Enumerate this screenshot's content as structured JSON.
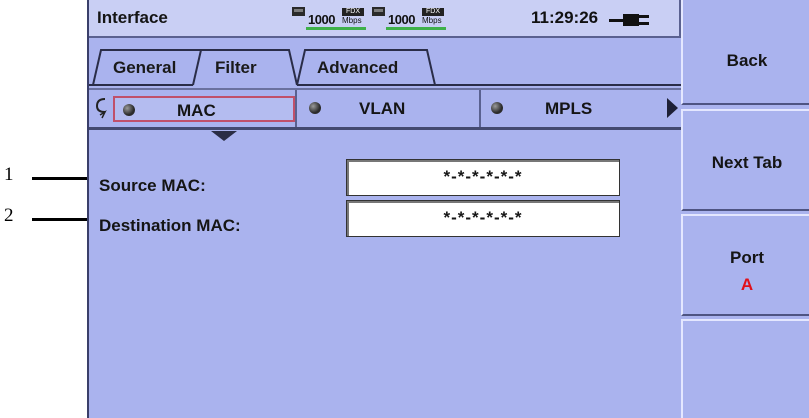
{
  "callouts": [
    "1",
    "2"
  ],
  "status_bar": {
    "title": "Interface",
    "port1": {
      "speed": "1000",
      "duplex": "FDX",
      "unit": "Mbps"
    },
    "port2": {
      "speed": "1000",
      "duplex": "FDX",
      "unit": "Mbps"
    },
    "time": "11:29:26"
  },
  "tabs": [
    {
      "label": "General"
    },
    {
      "label": "Filter"
    },
    {
      "label": "Advanced"
    }
  ],
  "sub_tabs": [
    {
      "label": "MAC"
    },
    {
      "label": "VLAN"
    },
    {
      "label": "MPLS"
    }
  ],
  "fields": {
    "source_mac": {
      "label": "Source MAC:",
      "value": "*-*-*-*-*-*"
    },
    "destination_mac": {
      "label": "Destination MAC:",
      "value": "*-*-*-*-*-*"
    }
  },
  "softkeys": {
    "back": "Back",
    "next_tab": "Next Tab",
    "port_label": "Port",
    "port_value": "A"
  },
  "colors": {
    "background": "#aab3ee",
    "port_value": "#e0101a",
    "link_active": "#3fb14a",
    "selected_border": "#c0506a"
  }
}
